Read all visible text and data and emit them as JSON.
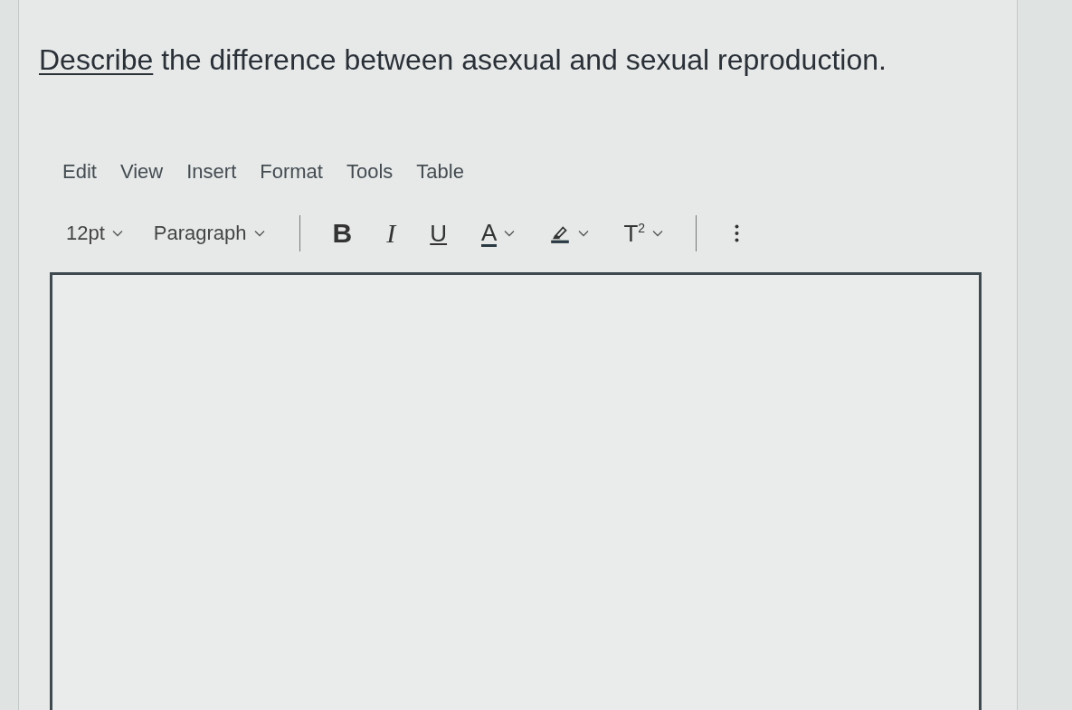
{
  "question": {
    "link": "Describe",
    "text": "the difference between asexual and sexual reproduction."
  },
  "menu": [
    "Edit",
    "View",
    "Insert",
    "Format",
    "Tools",
    "Table"
  ],
  "toolbar": [
    {
      "kind": "dropdown",
      "label": "12pt"
    },
    {
      "kind": "dropdown",
      "label": "Paragraph"
    },
    {
      "kind": "divider"
    },
    {
      "kind": "bold",
      "label": "B"
    },
    {
      "kind": "italic",
      "label": "I"
    },
    {
      "kind": "underline",
      "label": "U"
    },
    {
      "kind": "color",
      "label": "A"
    },
    {
      "kind": "highlight"
    },
    {
      "kind": "super",
      "label": "T$^{2}$"
    },
    {
      "kind": "divider"
    },
    {
      "kind": "more"
    }
  ],
  "editor": {
    "kind": "rich-text"
  }
}
